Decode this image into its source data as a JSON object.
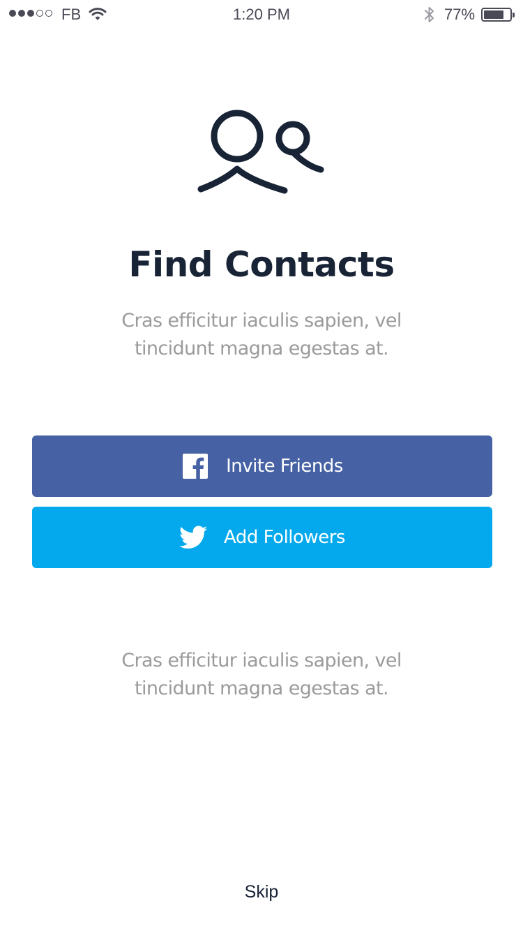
{
  "status_bar": {
    "signal_filled": 3,
    "signal_total": 5,
    "carrier": "FB",
    "time": "1:20 PM",
    "battery_percent": "77%",
    "battery_level": 0.77,
    "icons": [
      "signal-icon",
      "wifi-icon",
      "bluetooth-icon",
      "battery-icon"
    ]
  },
  "hero": {
    "icon": "contacts-icon",
    "title": "Find Contacts",
    "description": "Cras efficitur iaculis sapien, vel tincidunt magna egestas at."
  },
  "buttons": {
    "facebook": {
      "label": "Invite Friends",
      "icon": "facebook-icon",
      "color": "#4661a4"
    },
    "twitter": {
      "label": "Add Followers",
      "icon": "twitter-icon",
      "color": "#03a9ec"
    }
  },
  "footer": {
    "note": "Cras efficitur iaculis sapien, vel tincidunt magna egestas at.",
    "skip_label": "Skip"
  },
  "colors": {
    "text_primary": "#182335",
    "text_secondary": "#9b9b9b",
    "background": "#ffffff"
  }
}
